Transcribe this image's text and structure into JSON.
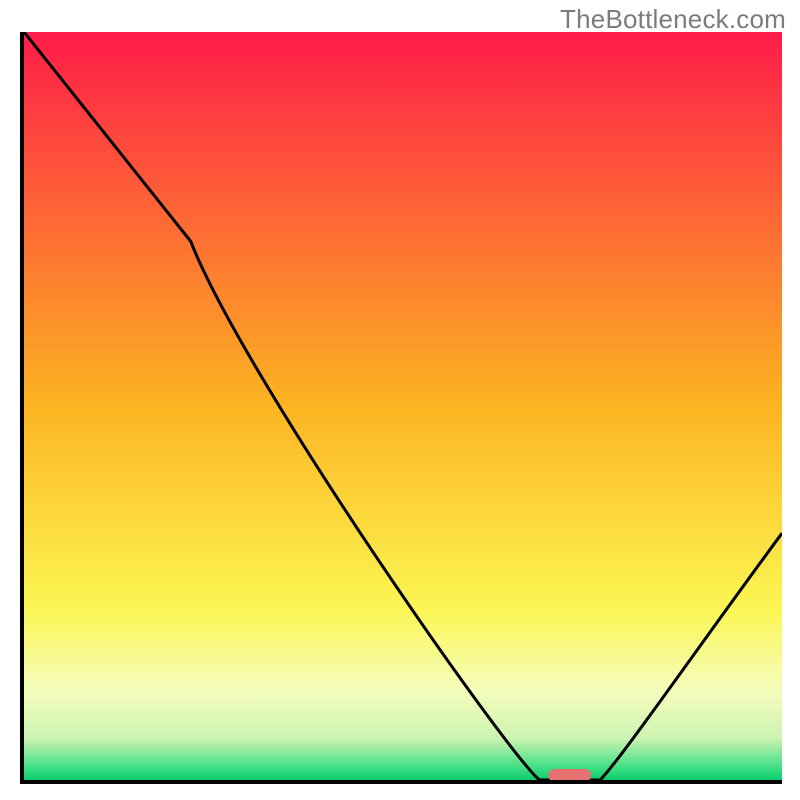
{
  "watermark": "TheBottleneck.com",
  "chart_data": {
    "type": "line",
    "title": "",
    "xlabel": "",
    "ylabel": "",
    "xlim": [
      0,
      100
    ],
    "ylim": [
      0,
      100
    ],
    "grid": false,
    "legend": false,
    "annotations": [
      {
        "name": "optimal-marker",
        "x": 72,
        "y": 0,
        "color": "#E77171"
      }
    ],
    "gradient_stops": [
      {
        "offset": 0.0,
        "color": "#FF1C49"
      },
      {
        "offset": 0.5,
        "color": "#FCB421"
      },
      {
        "offset": 0.77,
        "color": "#FBF653"
      },
      {
        "offset": 0.88,
        "color": "#F6FDBC"
      },
      {
        "offset": 0.945,
        "color": "#CCF3B1"
      },
      {
        "offset": 0.985,
        "color": "#3ADE83"
      },
      {
        "offset": 1.0,
        "color": "#0CCB6B"
      }
    ],
    "series": [
      {
        "name": "bottleneck-curve",
        "color": "#000000",
        "x": [
          0,
          22,
          68,
          76,
          100
        ],
        "values": [
          100,
          72,
          0,
          0,
          33
        ]
      }
    ]
  }
}
